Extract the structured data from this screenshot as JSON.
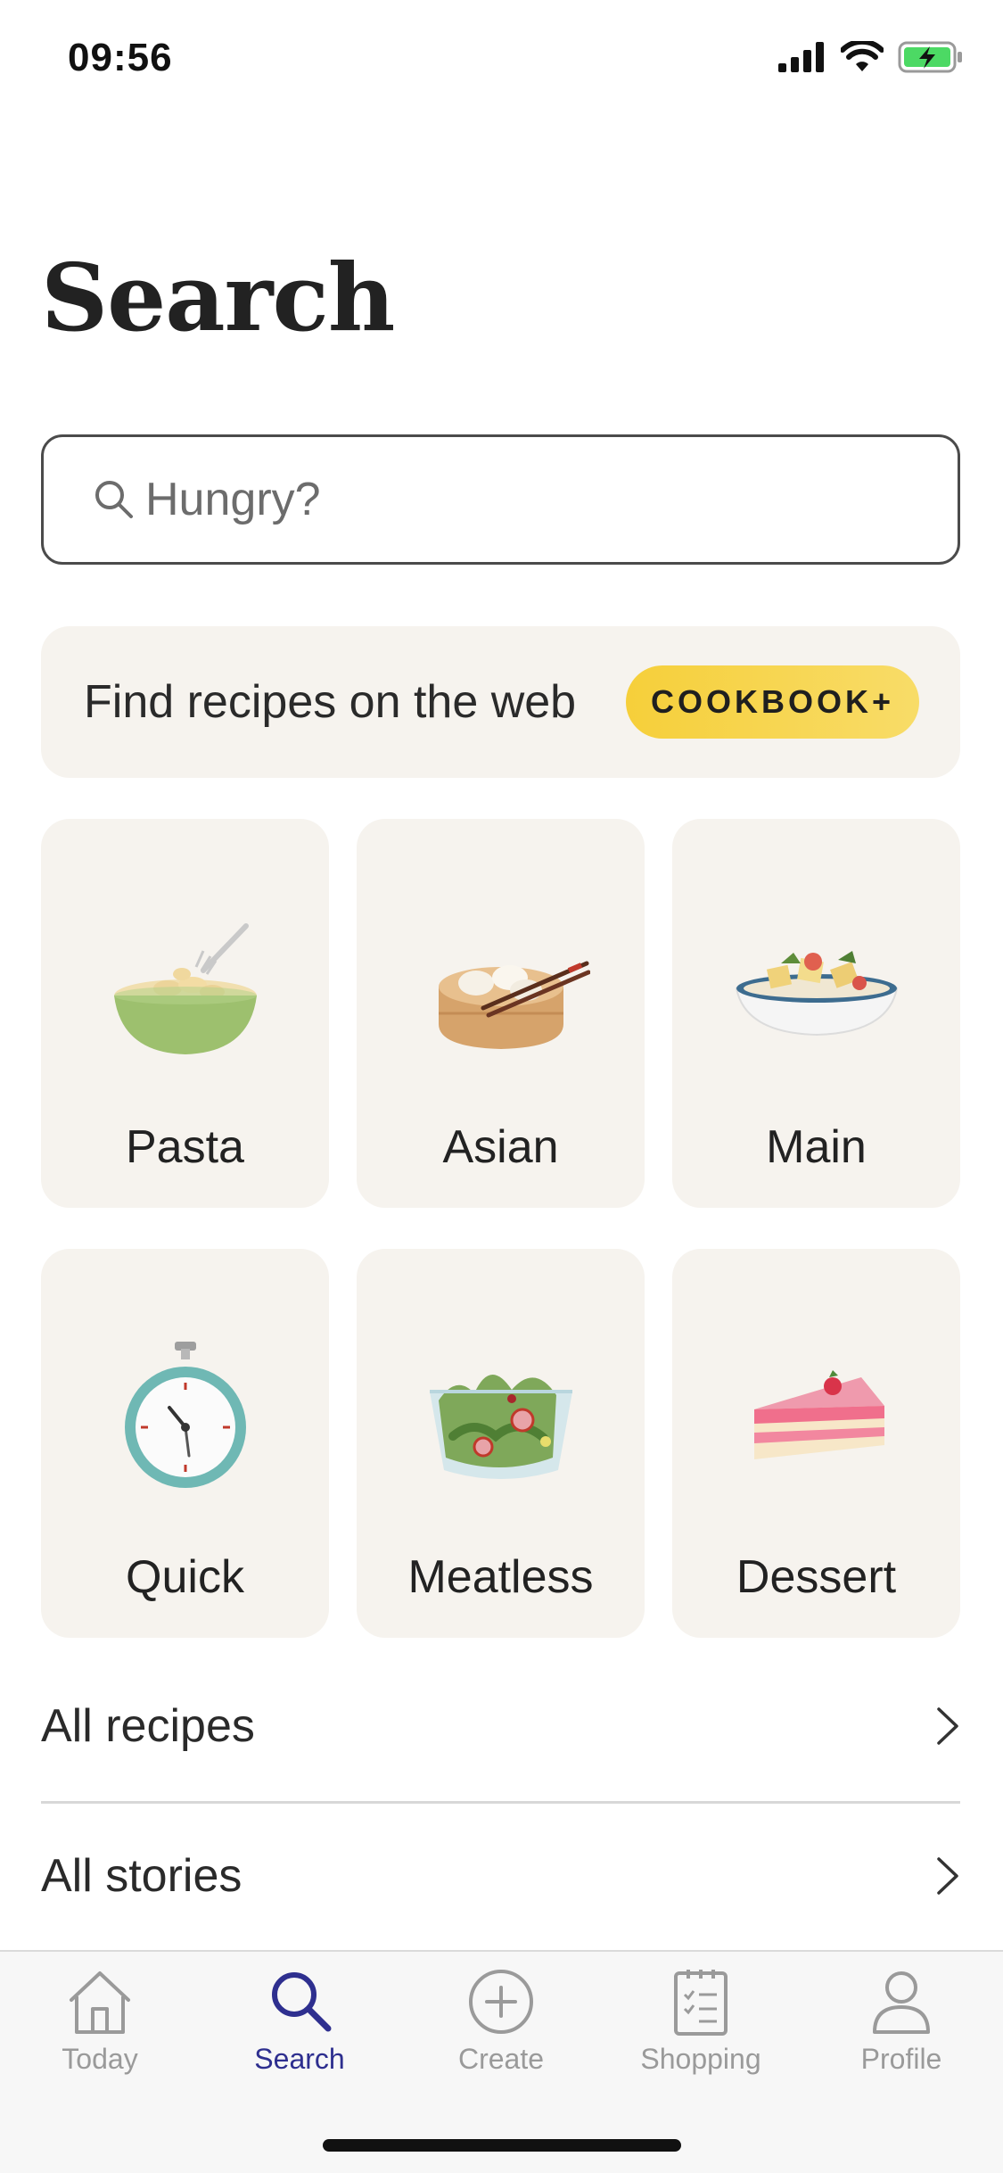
{
  "status_bar": {
    "time": "09:56"
  },
  "page": {
    "title": "Search"
  },
  "search": {
    "placeholder": "Hungry?"
  },
  "web_banner": {
    "label": "Find recipes on the web",
    "badge": "COOKBOOK+"
  },
  "categories": [
    {
      "label": "Pasta",
      "icon": "pasta-bowl-icon"
    },
    {
      "label": "Asian",
      "icon": "dumpling-steamer-icon"
    },
    {
      "label": "Main",
      "icon": "main-dish-bowl-icon"
    },
    {
      "label": "Quick",
      "icon": "stopwatch-icon"
    },
    {
      "label": "Meatless",
      "icon": "salad-bowl-icon"
    },
    {
      "label": "Dessert",
      "icon": "cake-slice-icon"
    }
  ],
  "links": [
    {
      "label": "All recipes"
    },
    {
      "label": "All stories"
    }
  ],
  "tab_bar": {
    "active": "Search",
    "tabs": [
      {
        "label": "Today",
        "icon": "home-icon"
      },
      {
        "label": "Search",
        "icon": "search-icon"
      },
      {
        "label": "Create",
        "icon": "plus-circle-icon"
      },
      {
        "label": "Shopping",
        "icon": "checklist-icon"
      },
      {
        "label": "Profile",
        "icon": "person-icon"
      }
    ]
  },
  "colors": {
    "accent": "#2e2f8f",
    "card_background": "#f6f3ee",
    "badge_yellow": "#f6cf3a",
    "tab_inactive": "#9a9a9a"
  }
}
